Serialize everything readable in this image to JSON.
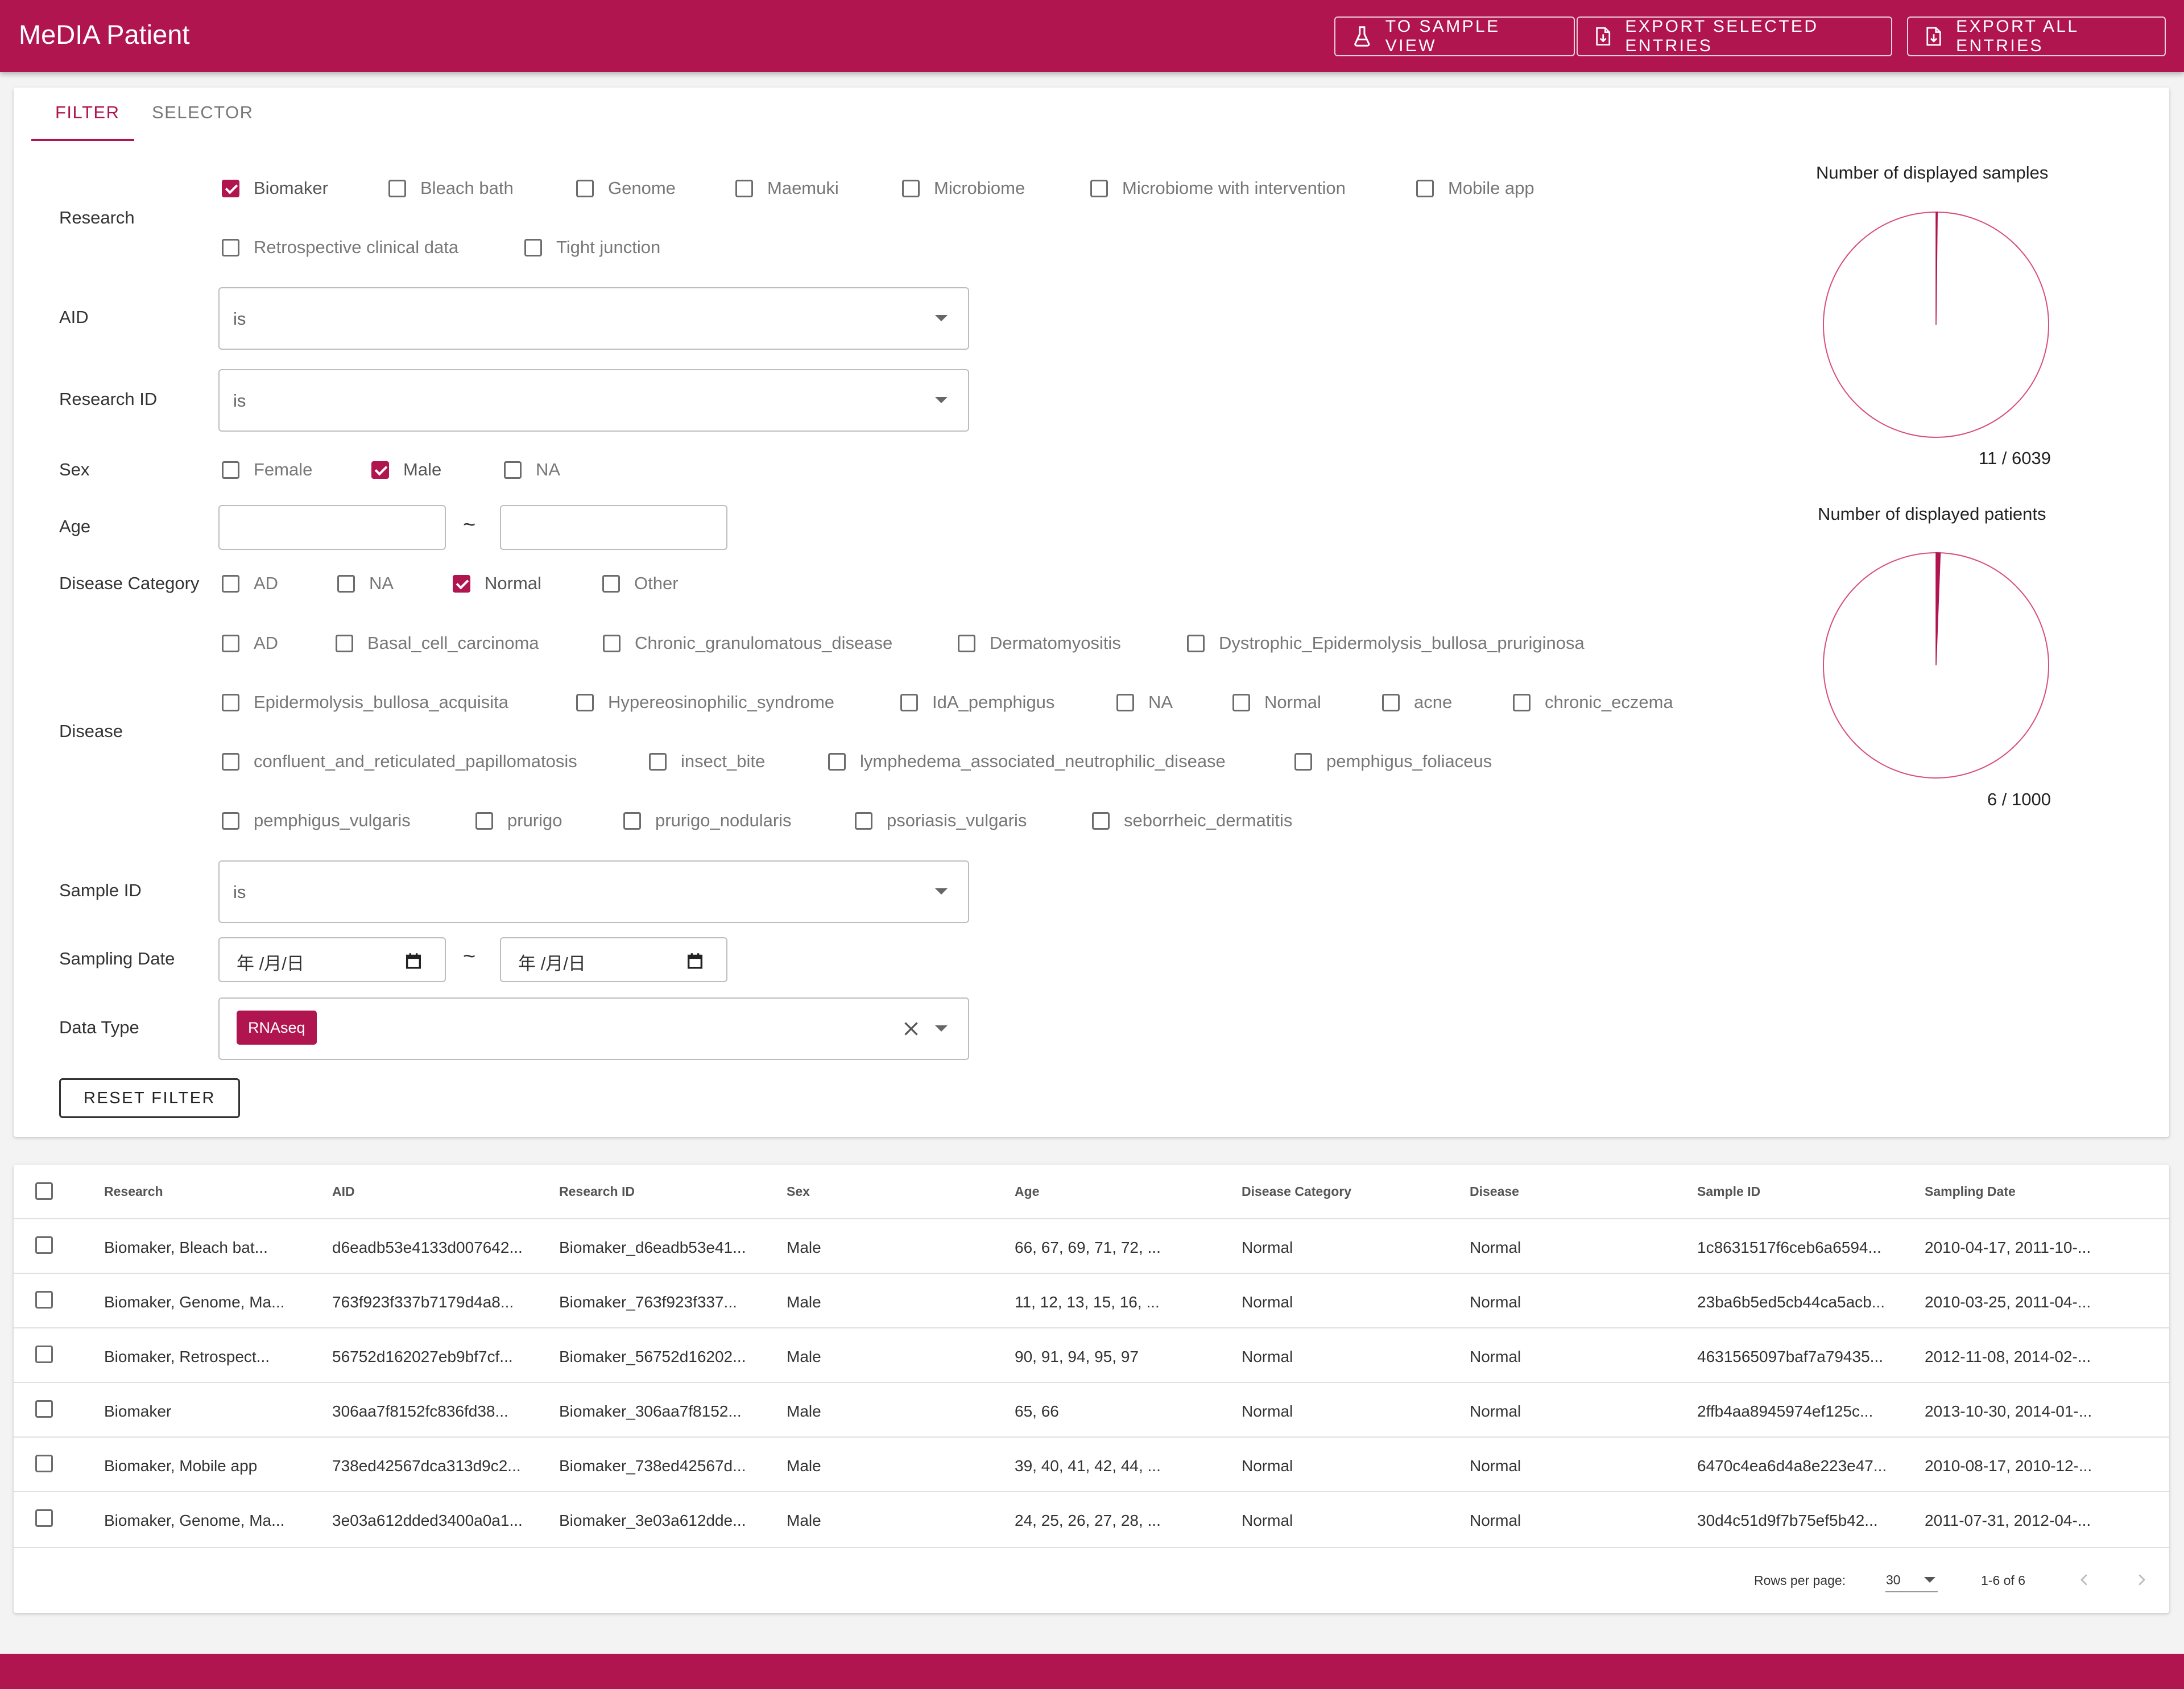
{
  "app": {
    "title": "MeDIA Patient",
    "accent_color": "#b0154f",
    "buttons": {
      "sample_view": "TO SAMPLE VIEW",
      "export_selected": "EXPORT SELECTED ENTRIES",
      "export_all": "EXPORT ALL ENTRIES"
    }
  },
  "tabs": [
    {
      "label": "FILTER",
      "active": true
    },
    {
      "label": "SELECTOR",
      "active": false
    }
  ],
  "filter": {
    "research": {
      "label": "Research",
      "options": [
        {
          "label": "Biomaker",
          "checked": true
        },
        {
          "label": "Bleach bath",
          "checked": false
        },
        {
          "label": "Genome",
          "checked": false
        },
        {
          "label": "Maemuki",
          "checked": false
        },
        {
          "label": "Microbiome",
          "checked": false
        },
        {
          "label": "Microbiome with intervention",
          "checked": false
        },
        {
          "label": "Mobile app",
          "checked": false
        },
        {
          "label": "Retrospective clinical data",
          "checked": false
        },
        {
          "label": "Tight junction",
          "checked": false
        }
      ]
    },
    "aid": {
      "label": "AID",
      "value": "is"
    },
    "research_id": {
      "label": "Research ID",
      "value": "is"
    },
    "sex": {
      "label": "Sex",
      "options": [
        {
          "label": "Female",
          "checked": false
        },
        {
          "label": "Male",
          "checked": true
        },
        {
          "label": "NA",
          "checked": false
        }
      ]
    },
    "age": {
      "label": "Age",
      "from": "",
      "to": "",
      "separator": "~"
    },
    "disease_category": {
      "label": "Disease Category",
      "options": [
        {
          "label": "AD",
          "checked": false
        },
        {
          "label": "NA",
          "checked": false
        },
        {
          "label": "Normal",
          "checked": true
        },
        {
          "label": "Other",
          "checked": false
        }
      ]
    },
    "disease": {
      "label": "Disease",
      "options": [
        {
          "label": "AD",
          "checked": false
        },
        {
          "label": "Basal_cell_carcinoma",
          "checked": false
        },
        {
          "label": "Chronic_granulomatous_disease",
          "checked": false
        },
        {
          "label": "Dermatomyositis",
          "checked": false
        },
        {
          "label": "Dystrophic_Epidermolysis_bullosa_pruriginosa",
          "checked": false
        },
        {
          "label": "Epidermolysis_bullosa_acquisita",
          "checked": false
        },
        {
          "label": "Hypereosinophilic_syndrome",
          "checked": false
        },
        {
          "label": "IdA_pemphigus",
          "checked": false
        },
        {
          "label": "NA",
          "checked": false
        },
        {
          "label": "Normal",
          "checked": false
        },
        {
          "label": "acne",
          "checked": false
        },
        {
          "label": "chronic_eczema",
          "checked": false
        },
        {
          "label": "confluent_and_reticulated_papillomatosis",
          "checked": false
        },
        {
          "label": "insect_bite",
          "checked": false
        },
        {
          "label": "lymphedema_associated_neutrophilic_disease",
          "checked": false
        },
        {
          "label": "pemphigus_foliaceus",
          "checked": false
        },
        {
          "label": "pemphigus_vulgaris",
          "checked": false
        },
        {
          "label": "prurigo",
          "checked": false
        },
        {
          "label": "prurigo_nodularis",
          "checked": false
        },
        {
          "label": "psoriasis_vulgaris",
          "checked": false
        },
        {
          "label": "seborrheic_dermatitis",
          "checked": false
        }
      ]
    },
    "sample_id": {
      "label": "Sample ID",
      "value": "is"
    },
    "sampling_date": {
      "label": "Sampling Date",
      "from": "年 /月/日",
      "to": "年 /月/日",
      "separator": "~"
    },
    "data_type": {
      "label": "Data Type",
      "chips": [
        "RNAseq"
      ]
    },
    "reset_label": "RESET FILTER"
  },
  "stats": {
    "samples": {
      "title": "Number of displayed samples",
      "shown": 11,
      "total": 6039,
      "count_text": "11 / 6039"
    },
    "patients": {
      "title": "Number of displayed patients",
      "shown": 6,
      "total": 1000,
      "count_text": "6 / 1000"
    }
  },
  "table": {
    "columns": [
      "Research",
      "AID",
      "Research ID",
      "Sex",
      "Age",
      "Disease Category",
      "Disease",
      "Sample ID",
      "Sampling Date"
    ],
    "rows": [
      [
        "Biomaker, Bleach bat...",
        "d6eadb53e4133d007642...",
        "Biomaker_d6eadb53e41...",
        "Male",
        "66, 67, 69, 71, 72, ...",
        "Normal",
        "Normal",
        "1c8631517f6ceb6a6594...",
        "2010-04-17, 2011-10-..."
      ],
      [
        "Biomaker, Genome, Ma...",
        "763f923f337b7179d4a8...",
        "Biomaker_763f923f337...",
        "Male",
        "11, 12, 13, 15, 16, ...",
        "Normal",
        "Normal",
        "23ba6b5ed5cb44ca5acb...",
        "2010-03-25, 2011-04-..."
      ],
      [
        "Biomaker, Retrospect...",
        "56752d162027eb9bf7cf...",
        "Biomaker_56752d16202...",
        "Male",
        "90, 91, 94, 95, 97",
        "Normal",
        "Normal",
        "4631565097baf7a79435...",
        "2012-11-08, 2014-02-..."
      ],
      [
        "Biomaker",
        "306aa7f8152fc836fd38...",
        "Biomaker_306aa7f8152...",
        "Male",
        "65, 66",
        "Normal",
        "Normal",
        "2ffb4aa8945974ef125c...",
        "2013-10-30, 2014-01-..."
      ],
      [
        "Biomaker, Mobile app",
        "738ed42567dca313d9c2...",
        "Biomaker_738ed42567d...",
        "Male",
        "39, 40, 41, 42, 44, ...",
        "Normal",
        "Normal",
        "6470c4ea6d4a8e223e47...",
        "2010-08-17, 2010-12-..."
      ],
      [
        "Biomaker, Genome, Ma...",
        "3e03a612dded3400a0a1...",
        "Biomaker_3e03a612dde...",
        "Male",
        "24, 25, 26, 27, 28, ...",
        "Normal",
        "Normal",
        "30d4c51d9f7b75ef5b42...",
        "2011-07-31, 2012-04-..."
      ]
    ],
    "rows_per_page_label": "Rows per page:",
    "rows_per_page": "30",
    "range": "1-6 of 6"
  }
}
